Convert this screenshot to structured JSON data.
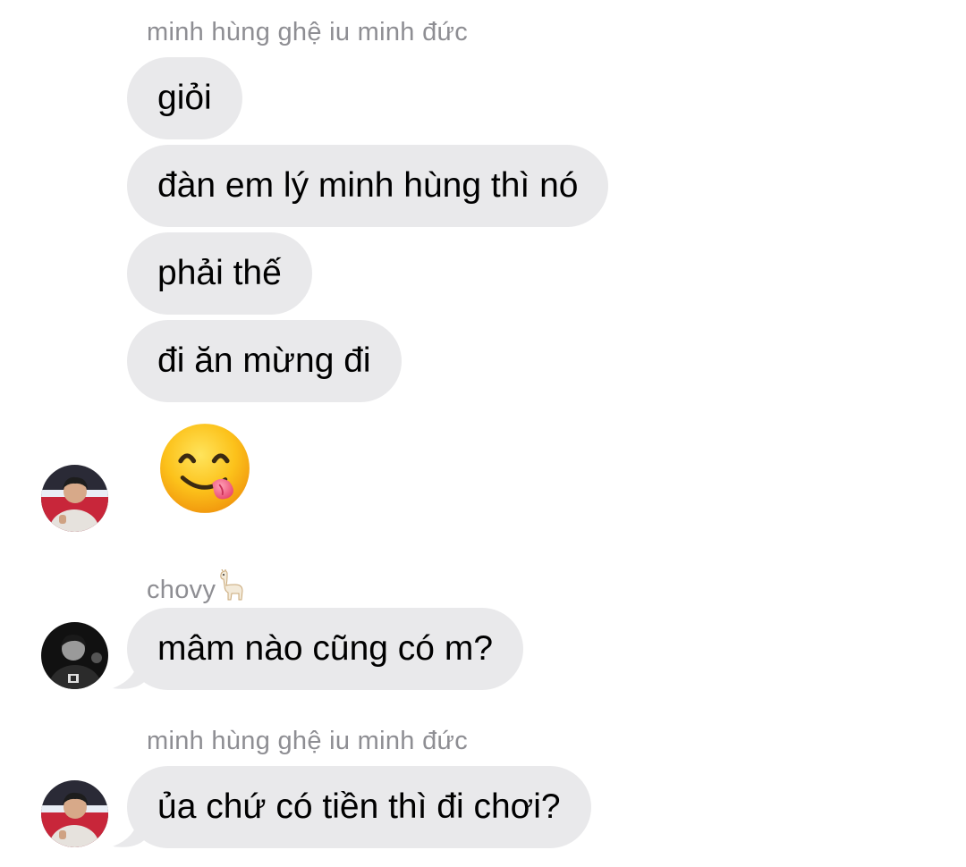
{
  "groups": [
    {
      "sender": "minh hùng ghệ iu minh đức",
      "messages": [
        "giỏi",
        "đàn em lý minh hùng thì nó",
        "phải thế",
        "đi ăn mừng đi"
      ],
      "emoji_message": "face-savoring-food-emoji",
      "avatar": "player-avatar-red-jersey"
    },
    {
      "sender": "chovy",
      "sender_suffix_icon": "llama-icon",
      "messages": [
        "mâm nào cũng có m?"
      ],
      "avatar": "player-avatar-dark"
    },
    {
      "sender": "minh hùng ghệ iu minh đức",
      "messages": [
        "ủa chứ có tiền thì đi chơi?"
      ],
      "avatar": "player-avatar-red-jersey"
    }
  ],
  "colors": {
    "incoming_bubble": "#e9e9eb",
    "sender_text": "#8e8e93",
    "message_text": "#000000",
    "background": "#ffffff"
  }
}
